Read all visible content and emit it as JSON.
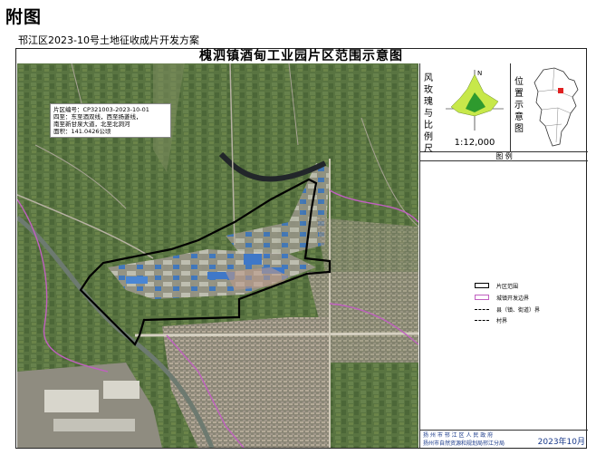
{
  "page": {
    "title": "附图",
    "subtitle": "邗江区2023-10号土地征收成片开发方案"
  },
  "map": {
    "title": "槐泗镇酒甸工业园片区范围示意图",
    "note_lines": [
      "片区编号：CP321003-2023-10-01",
      "四至：东至酒双线，西至扬菱线，",
      "南至新甘泉大道，北至北洞河",
      "面积：141.0426公顷"
    ]
  },
  "windrose": {
    "label_chars": [
      "风",
      "玫",
      "瑰",
      "与",
      "比",
      "例",
      "尺"
    ],
    "north": "N",
    "scale": "1:12,000"
  },
  "location_map": {
    "label_chars": [
      "位",
      "置",
      "示",
      "意",
      "图"
    ]
  },
  "legend": {
    "title": "图 例",
    "items": [
      {
        "label": "片区范围",
        "color": "#000000"
      },
      {
        "label": "城镇开发边界",
        "color": "#c060c0"
      },
      {
        "label": "县（镇、街道）界",
        "color": "#000000"
      },
      {
        "label": "村界",
        "color": "#000000"
      }
    ]
  },
  "footer": {
    "org_line1": "扬 州 市 邗 江 区 人 民 政 府",
    "org_line2": "扬州市自然资源和规划局邗江分局",
    "date": "2023年10月"
  },
  "colors": {
    "boundary": "#000000",
    "dev_boundary": "#c060c0",
    "wind_outer": "#c7e84a",
    "wind_inner": "#2e9a2e"
  }
}
